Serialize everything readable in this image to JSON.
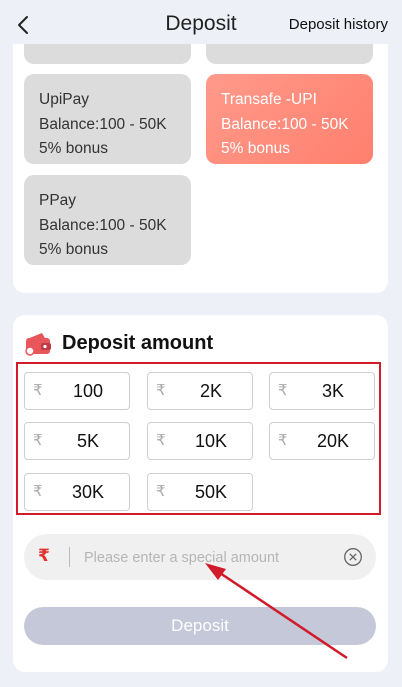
{
  "header": {
    "title": "Deposit",
    "history_label": "Deposit history"
  },
  "channels": [
    {
      "name": "UpiPay",
      "balance": "Balance:100 - 50K",
      "bonus": "5% bonus",
      "selected": false
    },
    {
      "name": "Transafe -UPI",
      "balance": "Balance:100 - 50K",
      "bonus": "5% bonus",
      "selected": true
    },
    {
      "name": "PPay",
      "balance": "Balance:100 - 50K",
      "bonus": "5% bonus",
      "selected": false
    }
  ],
  "amount_section": {
    "title": "Deposit amount",
    "currency_symbol": "₹",
    "options": [
      "100",
      "2K",
      "3K",
      "5K",
      "10K",
      "20K",
      "30K",
      "50K"
    ],
    "special_placeholder": "Please enter a special amount"
  },
  "deposit_button": "Deposit",
  "colors": {
    "selected_channel": "#ff8a7a",
    "highlight_border": "#d11a2a",
    "disabled_button": "#c5c8d8"
  }
}
